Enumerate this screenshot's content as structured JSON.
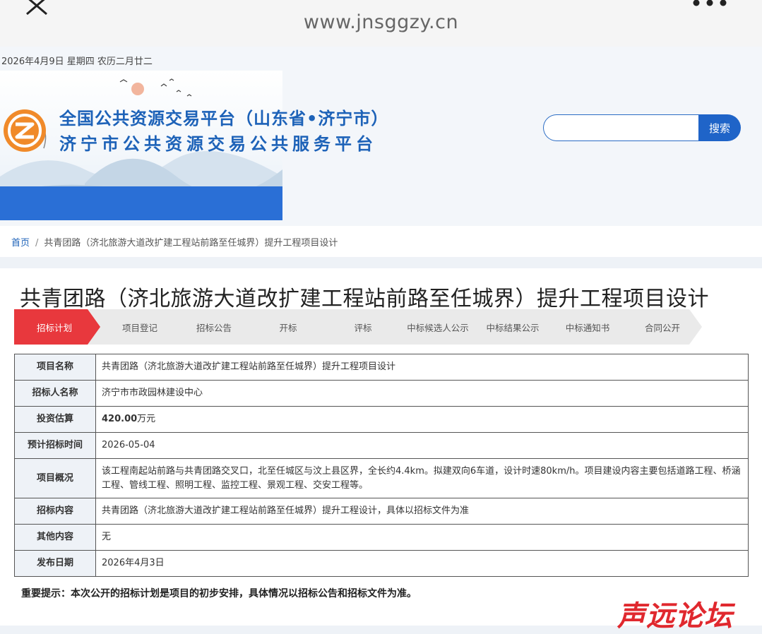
{
  "browser": {
    "url": "www.jnsggzy.cn",
    "icons": {
      "close": "close-icon",
      "more": "more-icon"
    }
  },
  "header": {
    "date": "2026年4月9日 星期四 农历二月廿二",
    "title_line1": "全国公共资源交易平台（山东省•济宁市）",
    "title_line2": "济宁市公共资源交易公共服务平台",
    "search_placeholder": "",
    "search_button": "搜索",
    "colors": {
      "brand_blue": "#1d62b8",
      "logo_orange": "#f08a2a"
    }
  },
  "breadcrumb": {
    "home": "首页",
    "separator": "/",
    "current": "共青团路（济北旅游大道改扩建工程站前路至任城界）提升工程项目设计"
  },
  "main": {
    "title": "共青团路（济北旅游大道改扩建工程站前路至任城界）提升工程项目设计",
    "steps": [
      "招标计划",
      "项目登记",
      "招标公告",
      "开标",
      "评标",
      "中标候选人公示",
      "中标结果公示",
      "中标通知书",
      "合同公开"
    ],
    "active_step": 0,
    "active_color": "#e8383d",
    "rows": [
      {
        "label": "项目名称",
        "value": "共青团路（济北旅游大道改扩建工程站前路至任城界）提升工程项目设计"
      },
      {
        "label": "招标人名称",
        "value": "济宁市市政园林建设中心"
      },
      {
        "label": "投资估算",
        "value_strong": "420.00",
        "value_unit": "万元"
      },
      {
        "label": "预计招标时间",
        "value": "2026-05-04"
      },
      {
        "label": "项目概况",
        "value": "该工程南起站前路与共青团路交叉口，北至任城区与汶上县区界，全长约4.4km。拟建双向6车道，设计时速80km/h。项目建设内容主要包括道路工程、桥涵工程、管线工程、照明工程、监控工程、景观工程、交安工程等。"
      },
      {
        "label": "招标内容",
        "value": "共青团路（济北旅游大道改扩建工程站前路至任城界）提升工程设计，具体以招标文件为准"
      },
      {
        "label": "其他内容",
        "value": "无"
      },
      {
        "label": "发布日期",
        "value": "2026年4月3日"
      }
    ],
    "tip": "重要提示：本次公开的招标计划是项目的初步安排，具体情况以招标公告和招标文件为准。"
  },
  "watermark": "声远论坛"
}
